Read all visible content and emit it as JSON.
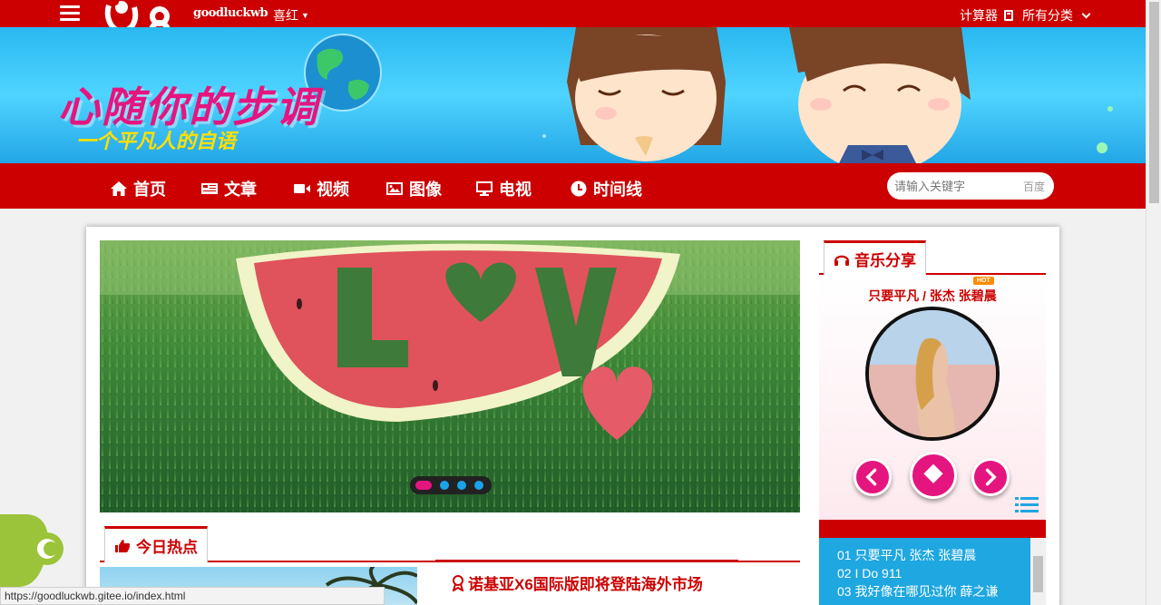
{
  "topbar": {
    "site_name": "goodluckwb",
    "theme_label": "喜红",
    "calculator_label": "计算器",
    "categories_label": "所有分类"
  },
  "banner": {
    "title": "心随你的步调",
    "subtitle": "一个平凡人的自语"
  },
  "nav": {
    "items": [
      {
        "label": "首页",
        "icon": "home-icon"
      },
      {
        "label": "文章",
        "icon": "newspaper-icon"
      },
      {
        "label": "视频",
        "icon": "video-camera-icon"
      },
      {
        "label": "图像",
        "icon": "image-icon"
      },
      {
        "label": "电视",
        "icon": "desktop-icon"
      },
      {
        "label": "时间线",
        "icon": "clock-icon"
      }
    ],
    "search_placeholder": "请输入关键字",
    "search_button": "百度"
  },
  "slider": {
    "dot_count": 4,
    "active_dot": 1
  },
  "today_hot": {
    "tab_label": "今日热点",
    "news_title": "诺基亚X6国际版即将登陆海外市场"
  },
  "music": {
    "tab_label": "音乐分享",
    "hot_badge": "HOT",
    "now_playing": "只要平凡 / 张杰 张碧晨",
    "playlist": [
      "01 只要平凡 张杰 张碧晨",
      "02 I Do 911",
      "03 我好像在哪见过你 薛之谦"
    ]
  },
  "statusbar": {
    "url": "https://goodluckwb.gitee.io/index.html"
  },
  "colors": {
    "brand_red": "#cc0000",
    "accent_pink": "#e5157f",
    "accent_blue": "#1ea7e1",
    "banner_sub_yellow": "#ffe000"
  }
}
